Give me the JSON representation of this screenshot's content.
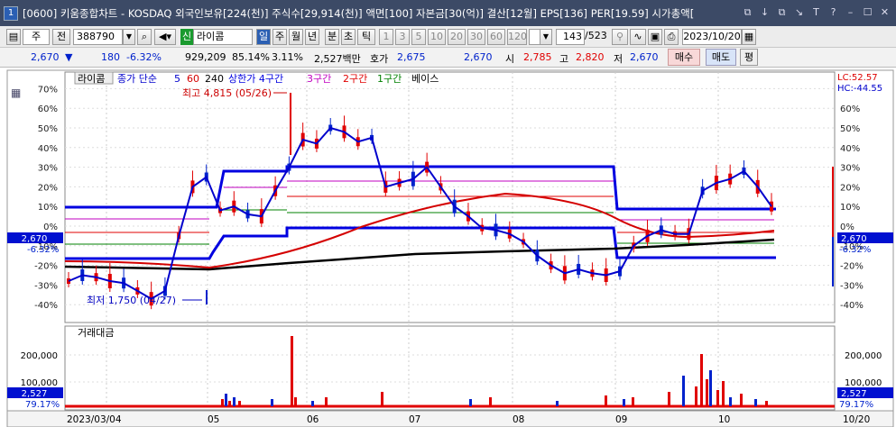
{
  "window": {
    "number": "1",
    "title": "[0600] 키움종합차트 - KOSDAQ 외국인보유[224(천)] 주식수[29,914(천)] 액면[100] 자본금[30(억)] 결산[12월] EPS[136] PER[19.59] 시가총액[",
    "icons": [
      "⧉",
      "↓",
      "⧉",
      "↘",
      "T",
      "?",
      "–",
      "☐",
      "✕"
    ]
  },
  "toolbar": {
    "type_label": "주",
    "period_label": "전",
    "code": "388790",
    "badge": "신",
    "name": "라이콤",
    "periods": [
      "일",
      "주",
      "월",
      "년",
      "분",
      "초",
      "틱"
    ],
    "intervals": [
      "1",
      "3",
      "5",
      "10",
      "20",
      "30",
      "60",
      "120"
    ],
    "count": "143",
    "total": "/523",
    "date": "2023/10/20"
  },
  "quote": {
    "price": "2,670",
    "arrow": "▼",
    "change": "180",
    "rate": "-6.32%",
    "volume": "929,209",
    "ratio": "85.14%",
    "turnover": "3.11%",
    "amount": "2,527백만",
    "ask_label": "호가",
    "ask": "2,675",
    "bid": "2,670",
    "open_label": "시",
    "open": "2,785",
    "high_label": "고",
    "high": "2,820",
    "low_label": "저",
    "low": "2,670",
    "buy": "매수",
    "sell": "매도",
    "eval": "평"
  },
  "legend": {
    "name": "라이콤",
    "ma_label": "종가 단순",
    "ma5": "5",
    "ma60": "60",
    "ma240": "240",
    "band_label": "상한가 4구간",
    "band3": "3구간",
    "band2": "2구간",
    "band1": "1구간",
    "base": "베이스"
  },
  "colors": {
    "up": "#e00000",
    "down": "#0022cc",
    "ma5": "#0000cc",
    "ma60": "#d40000",
    "ma240": "#000000",
    "band4": "#0000e0",
    "band3": "#c000c0",
    "band2": "#e00000",
    "band1": "#008000"
  },
  "annotations": {
    "max": "최고 4,815 (05/26)",
    "min": "최저 1,750 (04/27)"
  },
  "right_labels": {
    "lc": "LC:52.57",
    "hc": "HC:-44.55",
    "price": "2,670",
    "pct": "-6.32%",
    "vol": "2,527",
    "volpct": "79.17%"
  },
  "left_labels": {
    "price": "2,670",
    "pct": "-6.32%",
    "vol": "2,527",
    "volpct": "79.17%"
  },
  "vol_title": "거래대금",
  "chart_data": {
    "type": "candlestick",
    "y_ticks": [
      "70%",
      "60%",
      "50%",
      "40%",
      "30%",
      "20%",
      "10%",
      "0%",
      "-10%",
      "-20%",
      "-30%",
      "-40%"
    ],
    "y_right_ticks": [
      "60%",
      "50%",
      "40%",
      "30%",
      "20%",
      "10%",
      "0%",
      "-10%",
      "-20%",
      "-30%",
      "-40%"
    ],
    "vol_ticks": [
      "200,000",
      "100,000"
    ],
    "x_labels": [
      "2023/03/04",
      "05",
      "06",
      "07",
      "08",
      "09",
      "10",
      "10/20"
    ],
    "ylim": [
      -40,
      70
    ],
    "ma5": [
      -28,
      -25,
      -26,
      -28,
      -29,
      -33,
      -37,
      -33,
      -5,
      20,
      25,
      8,
      10,
      6,
      5,
      18,
      30,
      44,
      42,
      50,
      48,
      43,
      45,
      20,
      22,
      24,
      30,
      20,
      10,
      5,
      -1,
      -2,
      -4,
      -8,
      -15,
      -20,
      -24,
      -22,
      -24,
      -25,
      -23,
      -10,
      -5,
      -2,
      -4,
      -4,
      18,
      22,
      24,
      28,
      20,
      10
    ]
  }
}
